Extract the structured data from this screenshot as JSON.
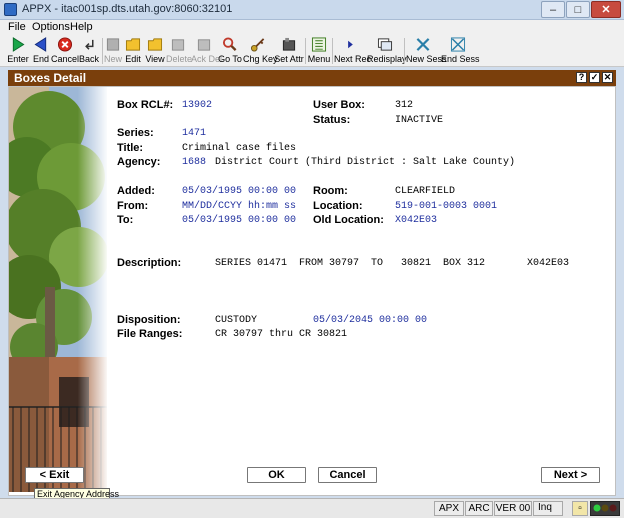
{
  "window": {
    "title": "APPX - itac001sp.dts.utah.gov:8060:32101",
    "minimize": "–",
    "maximize": "□",
    "close": "✕"
  },
  "menu": [
    "File",
    "Options",
    "Help"
  ],
  "toolbar": {
    "enter": "Enter",
    "end": "End",
    "cancel": "Cancel",
    "back": "Back",
    "new": "New",
    "edit": "Edit",
    "view": "View",
    "delete": "Delete",
    "ack_del": "Ack Del",
    "goto": "Go To",
    "chg_key": "Chg Key",
    "set_attr": "Set Attr",
    "menu": "Menu",
    "next_rec": "Next Rec",
    "redisplay": "Redisplay",
    "new_sess": "New Sess",
    "end_sess": "End Sess"
  },
  "header": {
    "title": "Boxes Detail",
    "help": "?",
    "check": "✓",
    "close": "✕"
  },
  "fields": {
    "box_rcl_label": "Box RCL#:",
    "box_rcl": "13902",
    "user_box_label": "User Box:",
    "user_box": "312",
    "status_label": "Status:",
    "status": "INACTIVE",
    "series_label": "Series:",
    "series": "1471",
    "title_label": "Title:",
    "title": "Criminal case files",
    "agency_label": "Agency:",
    "agency_code": "1688",
    "agency_name": "District Court (Third District : Salt Lake County)",
    "added_label": "Added:",
    "added": "05/03/1995 00:00 00",
    "room_label": "Room:",
    "room": "CLEARFIELD",
    "from_label": "From:",
    "from": "MM/DD/CCYY hh:mm ss",
    "location_label": "Location:",
    "location": "519-001-0003 0001",
    "to_label": "To:",
    "to": "05/03/1995 00:00 00",
    "old_location_label": "Old Location:",
    "old_location": "X042E03",
    "description_label": "Description:",
    "description": "SERIES 01471  FROM 30797  TO   30821  BOX 312       X042E03",
    "disposition_label": "Disposition:",
    "disposition": "CUSTODY",
    "disposition_date": "05/03/2045 00:00 00",
    "file_ranges_label": "File Ranges:",
    "file_ranges": "CR 30797 thru CR 30821"
  },
  "buttons": {
    "exit": "< Exit",
    "ok": "OK",
    "cancel": "Cancel",
    "next": "Next >"
  },
  "tooltip": "Exit Agency Address",
  "statusbar": {
    "apx": "APX",
    "arc": "ARC",
    "ver": "VER 00",
    "inq": "Inq"
  },
  "colors": {
    "header_bg": "#7a3f0c",
    "value_blue": "#1f2f9e"
  }
}
